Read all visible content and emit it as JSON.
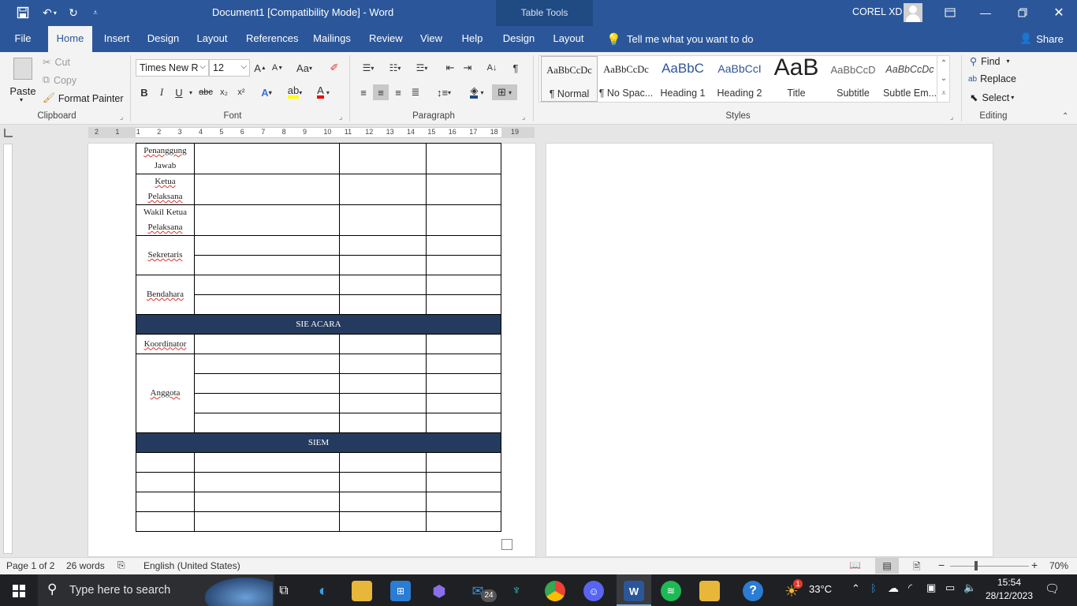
{
  "window": {
    "title": "Document1 [Compatibility Mode]  -  Word",
    "context_tab_group": "Table Tools",
    "user": "COREL XD"
  },
  "tabs": [
    "File",
    "Home",
    "Insert",
    "Design",
    "Layout",
    "References",
    "Mailings",
    "Review",
    "View",
    "Help",
    "Design",
    "Layout"
  ],
  "tell_me": "Tell me what you want to do",
  "share": "Share",
  "clipboard": {
    "paste": "Paste",
    "cut": "Cut",
    "copy": "Copy",
    "format_painter": "Format Painter",
    "label": "Clipboard"
  },
  "font": {
    "name": "Times New R",
    "size": "12",
    "label": "Font",
    "case": "Aa",
    "bold": "B",
    "italic": "I",
    "underline": "U",
    "strike": "abc"
  },
  "paragraph": {
    "label": "Paragraph"
  },
  "styles": {
    "label": "Styles",
    "items": [
      {
        "preview": "AaBbCcDc",
        "name": "¶ Normal"
      },
      {
        "preview": "AaBbCcDc",
        "name": "¶ No Spac..."
      },
      {
        "preview": "AaBbC",
        "name": "Heading 1"
      },
      {
        "preview": "AaBbCcI",
        "name": "Heading 2"
      },
      {
        "preview": "AaB",
        "name": "Title"
      },
      {
        "preview": "AaBbCcD",
        "name": "Subtitle"
      },
      {
        "preview": "AaBbCcDc",
        "name": "Subtle Em..."
      }
    ]
  },
  "editing": {
    "find": "Find",
    "replace": "Replace",
    "select": "Select",
    "label": "Editing"
  },
  "ruler_numbers": [
    "2",
    "1",
    "1",
    "2",
    "3",
    "4",
    "5",
    "6",
    "7",
    "8",
    "9",
    "10",
    "11",
    "12",
    "13",
    "14",
    "15",
    "16",
    "17",
    "18",
    "19"
  ],
  "table": {
    "rows": {
      "penanggung": [
        "Penanggung",
        "Jawab"
      ],
      "ketua": [
        "Ketua",
        "Pelaksana"
      ],
      "wakil": [
        "Wakil Ketua",
        "Pelaksana"
      ],
      "sekretaris": "Sekretaris",
      "bendahara": "Bendahara",
      "band1": "SIE ACARA",
      "koordinator": "Koordinator",
      "anggota": "Anggota",
      "band2": "SIEM"
    }
  },
  "status": {
    "page": "Page 1 of 2",
    "words": "26 words",
    "language": "English (United States)",
    "zoom": "70%"
  },
  "taskbar": {
    "search": "Type here to search",
    "temp": "33°C",
    "time": "15:54",
    "date": "28/12/2023",
    "mail_badge": "24",
    "weather_badge": "1"
  }
}
